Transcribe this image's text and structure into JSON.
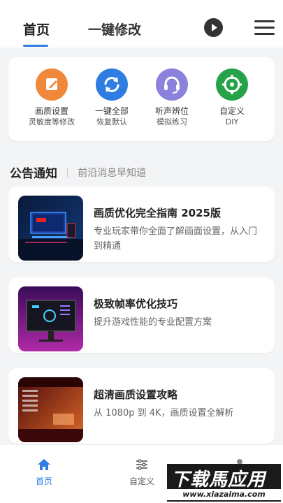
{
  "header": {
    "tabs": [
      {
        "label": "首页",
        "active": true
      },
      {
        "label": "一键修改",
        "active": false
      }
    ],
    "accent_color": "#2f7de1",
    "play_icon": "play-icon",
    "menu_icon": "menu-icon"
  },
  "quick_actions": [
    {
      "title": "画质设置",
      "subtitle": "灵敏度等修改",
      "icon": "edit-icon",
      "color": "#f0883a"
    },
    {
      "title": "一键全部",
      "subtitle": "恢复默认",
      "icon": "refresh-icon",
      "color": "#2f7de1"
    },
    {
      "title": "听声辨位",
      "subtitle": "模拟练习",
      "icon": "headset-icon",
      "color": "#8a82dc"
    },
    {
      "title": "自定义",
      "subtitle": "DIY",
      "icon": "crosshair-icon",
      "color": "#26a349"
    }
  ],
  "announcements": {
    "title": "公告通知",
    "subtitle": "前沿消息早知道",
    "items": [
      {
        "title": "画质优化完全指南 2025版",
        "description": "专业玩家带你全面了解画面设置，从入门到精通"
      },
      {
        "title": "极致帧率优化技巧",
        "description": "提升游戏性能的专业配置方案"
      },
      {
        "title": "超清画质设置攻略",
        "description": "从 1080p 到 4K，画质设置全解析"
      }
    ]
  },
  "bottom_nav": [
    {
      "label": "首页",
      "icon": "home-icon",
      "active": true
    },
    {
      "label": "自定义",
      "icon": "sliders-icon",
      "active": false
    },
    {
      "label": "",
      "icon": "user-icon",
      "active": false
    }
  ],
  "watermark": {
    "main": "下载馬应用",
    "url": "www.xiazaima.com"
  }
}
